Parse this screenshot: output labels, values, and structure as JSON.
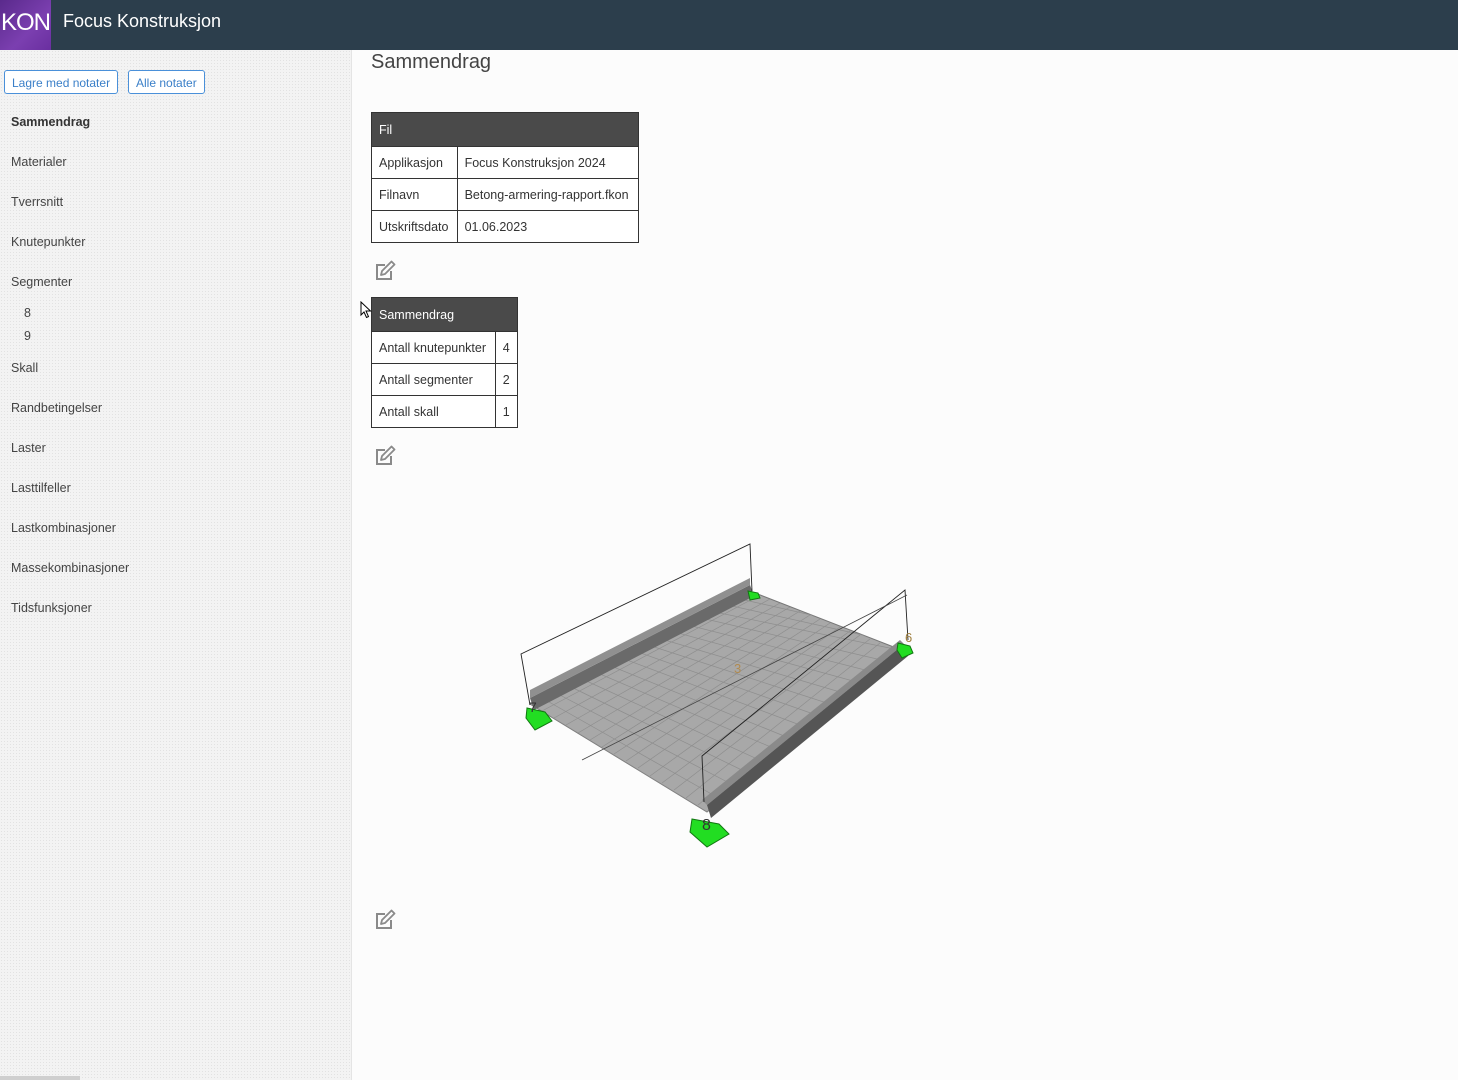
{
  "header": {
    "logo_text": "KON",
    "app_title": "Focus Konstruksjon"
  },
  "sidebar": {
    "buttons": [
      {
        "label": "Lagre med notater"
      },
      {
        "label": "Alle notater"
      }
    ],
    "items": [
      {
        "label": "Sammendrag"
      },
      {
        "label": "Materialer"
      },
      {
        "label": "Tverrsnitt"
      },
      {
        "label": "Knutepunkter"
      },
      {
        "label": "Segmenter"
      },
      {
        "label": "Skall"
      },
      {
        "label": "Randbetingelser"
      },
      {
        "label": "Laster"
      },
      {
        "label": "Lasttilfeller"
      },
      {
        "label": "Lastkombinasjoner"
      },
      {
        "label": "Massekombinasjoner"
      },
      {
        "label": "Tidsfunksjoner"
      }
    ],
    "sub_items": [
      {
        "label": "8"
      },
      {
        "label": "9"
      }
    ]
  },
  "main": {
    "title": "Sammendrag",
    "file_table": {
      "header": "Fil",
      "rows": [
        {
          "key": "Applikasjon",
          "value": "Focus Konstruksjon 2024"
        },
        {
          "key": "Filnavn",
          "value": "Betong-armering-rapport.fkon"
        },
        {
          "key": "Utskriftsdato",
          "value": "01.06.2023"
        }
      ]
    },
    "summary_table": {
      "header": "Sammendrag",
      "rows": [
        {
          "key": "Antall knutepunkter",
          "value": "4"
        },
        {
          "key": "Antall segmenter",
          "value": "2"
        },
        {
          "key": "Antall skall",
          "value": "1"
        }
      ]
    },
    "model_labels": {
      "node_a": "7",
      "node_b": "8",
      "node_c": "6",
      "shell": "3"
    }
  },
  "colors": {
    "topbar": "#2c3e4c",
    "logo": "#6a2fa0",
    "support": "#22dd22",
    "button_border": "#4a90d9"
  },
  "icons": {
    "edit": "edit-note-icon"
  }
}
